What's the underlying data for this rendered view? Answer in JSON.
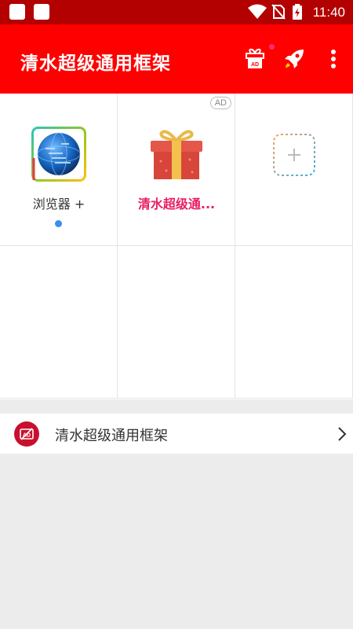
{
  "status_bar": {
    "time": "11:40"
  },
  "app_bar": {
    "title": "清水超级通用框架"
  },
  "grid": {
    "items": [
      {
        "label": "浏览器 +"
      },
      {
        "label": "清水超级通...",
        "badge": "AD"
      },
      {
        "label": ""
      }
    ]
  },
  "list": {
    "item_label": "清水超级通用框架"
  },
  "colors": {
    "app_bar": "#ff0000",
    "status_bar": "#b30000",
    "accent_pink": "#e91e63",
    "dot_blue": "#3a8ef0"
  }
}
